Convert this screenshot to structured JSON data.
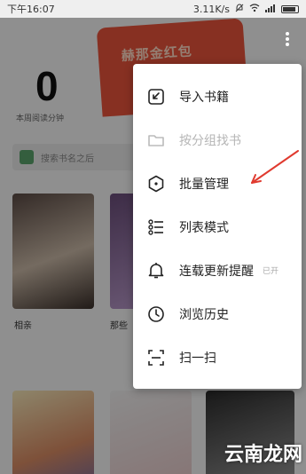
{
  "status_bar": {
    "time": "下午16:07",
    "network_speed": "3.11K/s"
  },
  "background": {
    "banner_text": "赫那金红包",
    "stat_number": "0",
    "stat_label": "本周阅读分钟",
    "search_placeholder": "搜索书名之后",
    "books": [
      {
        "title": "相亲"
      },
      {
        "title": "那些"
      }
    ]
  },
  "menu": {
    "items": [
      {
        "label": "导入书籍",
        "icon": "import-icon",
        "disabled": false
      },
      {
        "label": "按分组找书",
        "icon": "folder-icon",
        "disabled": true
      },
      {
        "label": "批量管理",
        "icon": "hexagon-icon",
        "disabled": false
      },
      {
        "label": "列表模式",
        "icon": "list-icon",
        "disabled": false
      },
      {
        "label": "连载更新提醒",
        "icon": "bell-icon",
        "disabled": false,
        "badge": "已开"
      },
      {
        "label": "浏览历史",
        "icon": "clock-icon",
        "disabled": false
      },
      {
        "label": "扫一扫",
        "icon": "scan-icon",
        "disabled": false
      }
    ]
  },
  "watermark": {
    "text": "云南龙网"
  },
  "colors": {
    "annotation_arrow": "#e03a2f",
    "banner": "#e8533c"
  }
}
